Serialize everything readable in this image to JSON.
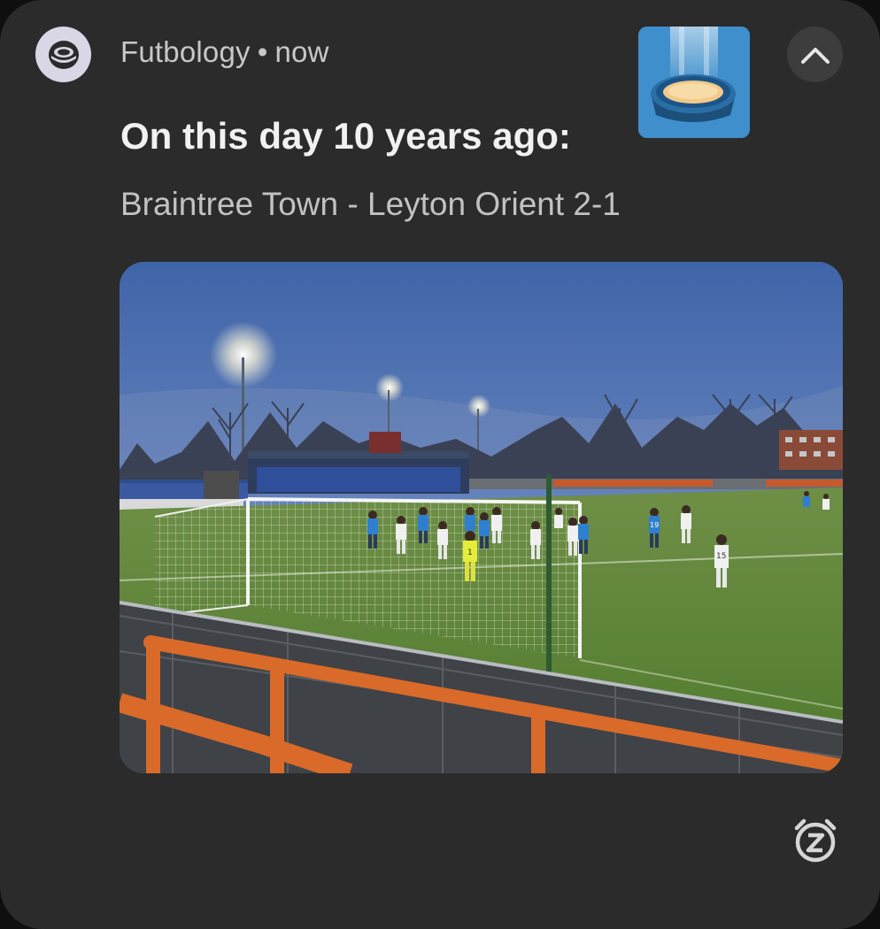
{
  "notification": {
    "app_name": "Futbology",
    "separator": "•",
    "time": "now",
    "title": "On this day 10 years ago:",
    "text": "Braintree Town - Leyton Orient 2-1",
    "app_icon": "stadium-logo-icon",
    "thumbnail": "stadium-illustration",
    "photo": "football-match-photo",
    "expand_control": "chevron-up-icon",
    "snooze_control": "snooze-alarm-icon"
  },
  "photo_scene": {
    "goalkeeper_number": "1",
    "players_numbers": [
      "19",
      "15"
    ]
  },
  "colors": {
    "card_background": "#2b2b2b",
    "app_icon_background": "#d9d6e6",
    "title_color": "#f1f1f1",
    "text_color": "#c2c2c2",
    "thumbnail_background": "#3f8fcc"
  }
}
